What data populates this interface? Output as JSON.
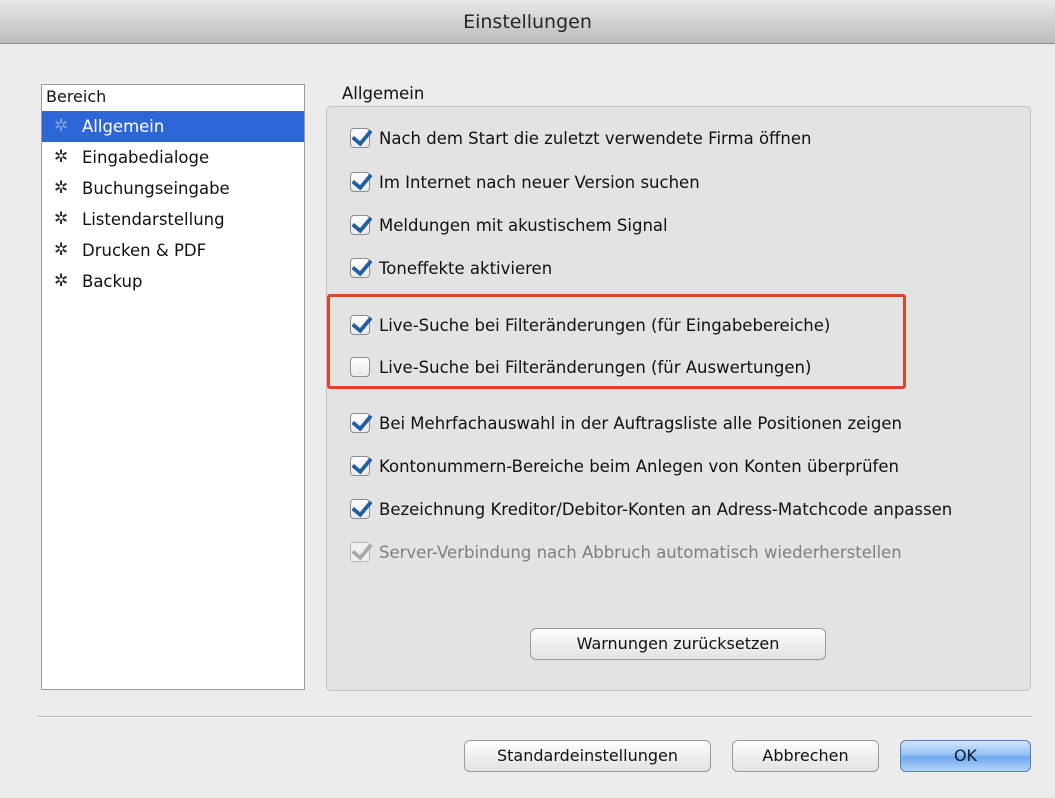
{
  "window": {
    "title": "Einstellungen"
  },
  "sidebar": {
    "header": "Bereich",
    "items": [
      {
        "label": "Allgemein",
        "selected": true,
        "icon": "gear-icon"
      },
      {
        "label": "Eingabedialoge",
        "selected": false,
        "icon": "gear-icon"
      },
      {
        "label": "Buchungseingabe",
        "selected": false,
        "icon": "gear-icon"
      },
      {
        "label": "Listendarstellung",
        "selected": false,
        "icon": "gear-icon"
      },
      {
        "label": "Drucken & PDF",
        "selected": false,
        "icon": "gear-icon"
      },
      {
        "label": "Backup",
        "selected": false,
        "icon": "gear-icon"
      }
    ]
  },
  "main": {
    "group_title": "Allgemein",
    "options": [
      {
        "label": "Nach dem Start die zuletzt verwendete Firma öffnen",
        "checked": true,
        "enabled": true
      },
      {
        "label": "Im Internet nach neuer Version suchen",
        "checked": true,
        "enabled": true
      },
      {
        "label": "Meldungen mit akustischem Signal",
        "checked": true,
        "enabled": true
      },
      {
        "label": "Toneffekte aktivieren",
        "checked": true,
        "enabled": true
      },
      {
        "label": "Live-Suche bei Filteränderungen (für Eingabebereiche)",
        "checked": true,
        "enabled": true
      },
      {
        "label": "Live-Suche bei Filteränderungen (für Auswertungen)",
        "checked": false,
        "enabled": true
      },
      {
        "label": "Bei Mehrfachauswahl in der Auftragsliste alle Positionen zeigen",
        "checked": true,
        "enabled": true
      },
      {
        "label": "Kontonummern-Bereiche beim Anlegen von Konten überprüfen",
        "checked": true,
        "enabled": true
      },
      {
        "label": "Bezeichnung Kreditor/Debitor-Konten an Adress-Matchcode anpassen",
        "checked": true,
        "enabled": true
      },
      {
        "label": "Server-Verbindung nach Abbruch automatisch wiederherstellen",
        "checked": true,
        "enabled": false
      }
    ],
    "reset_warnings_button": "Warnungen zurücksetzen"
  },
  "footer": {
    "defaults_button": "Standardeinstellungen",
    "cancel_button": "Abbrechen",
    "ok_button": "OK"
  },
  "colors": {
    "selection": "#2d66d7",
    "checkmark": "#1f5fa3",
    "highlight_annotation": "#e2412a",
    "default_button": "#6aa7ee"
  }
}
